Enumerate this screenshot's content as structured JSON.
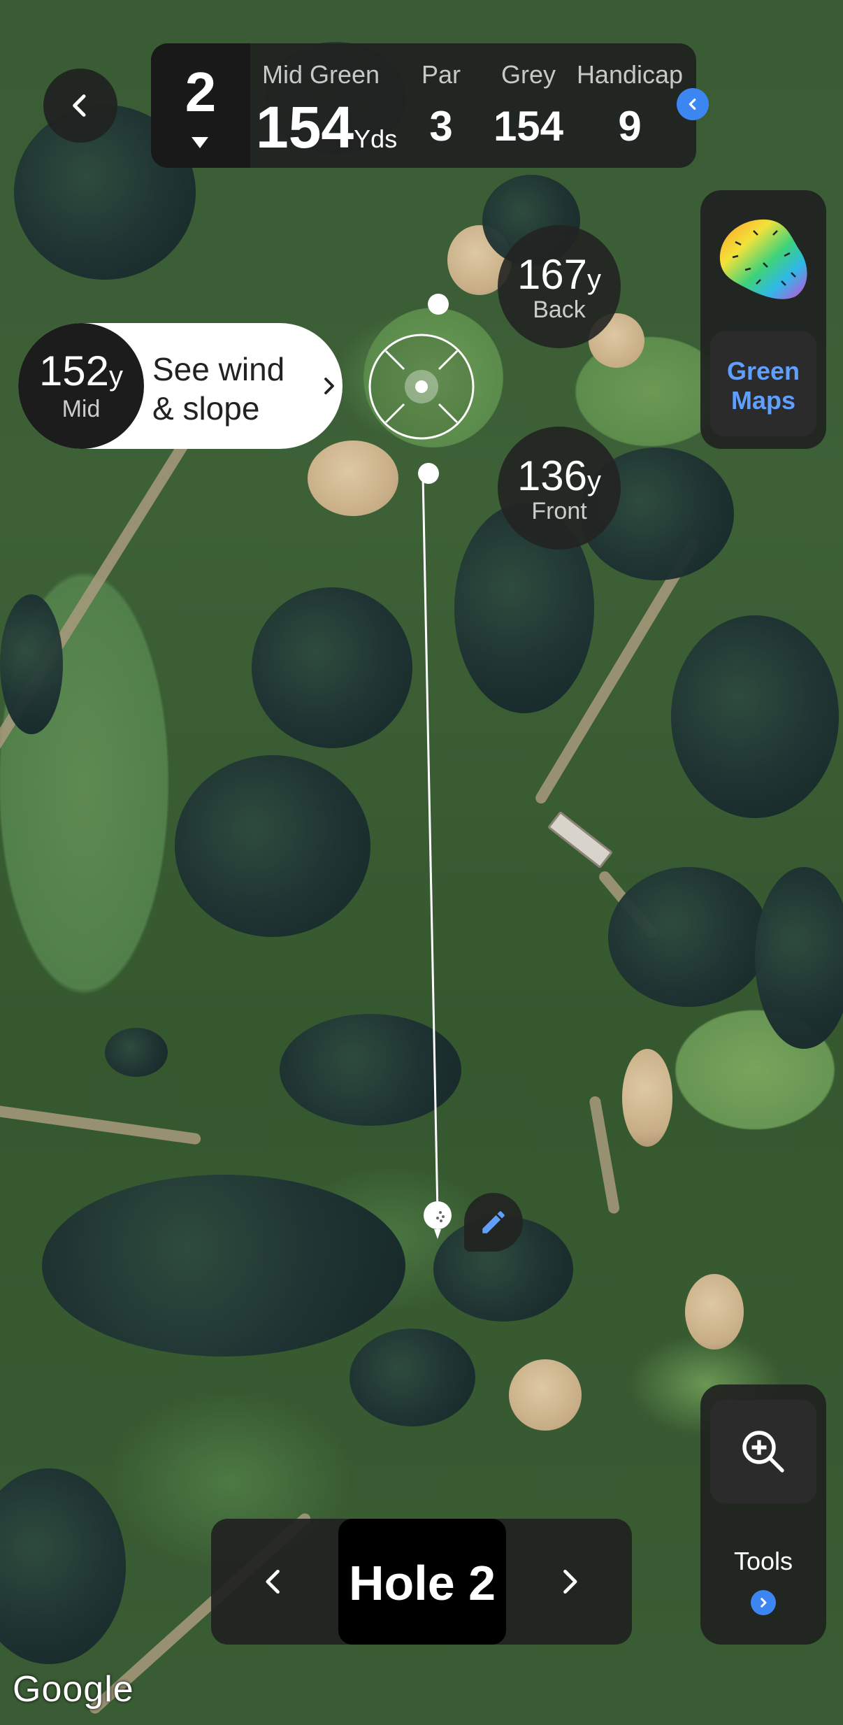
{
  "header": {
    "hole_number": "2",
    "mid_green_label": "Mid Green",
    "mid_green_value": "154",
    "mid_green_unit": "Yds",
    "par_label": "Par",
    "par_value": "3",
    "tee_label": "Grey",
    "tee_value": "154",
    "handicap_label": "Handicap",
    "handicap_value": "9"
  },
  "distances": {
    "back": {
      "value": "167",
      "unit": "y",
      "label": "Back"
    },
    "front": {
      "value": "136",
      "unit": "y",
      "label": "Front"
    },
    "mid": {
      "value": "152",
      "unit": "y",
      "label": "Mid"
    }
  },
  "wind": {
    "text_line1": "See wind",
    "text_line2": "& slope"
  },
  "green_maps": {
    "label_line1": "Green",
    "label_line2": "Maps"
  },
  "tools": {
    "label": "Tools"
  },
  "hole_nav": {
    "title": "Hole 2"
  },
  "map": {
    "attribution": "Google"
  },
  "colors": {
    "accent": "#3c86f2",
    "panel": "#202220",
    "link": "#5fa0ff"
  },
  "icons": [
    "back-chevron-icon",
    "chevron-down-icon",
    "expand-chevron-icon",
    "chevron-right-icon",
    "green-heatmap-icon",
    "zoom-in-icon",
    "edit-pencil-icon",
    "golf-ball-icon",
    "target-icon"
  ]
}
